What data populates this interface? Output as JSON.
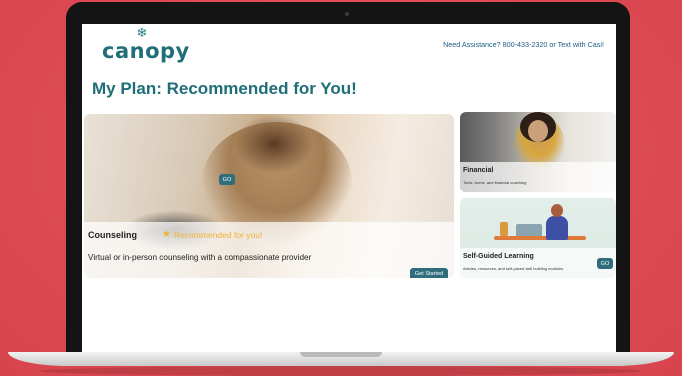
{
  "header": {
    "logo_icon": "snowflake-icon",
    "logo_text": "canopy",
    "assistance": "Need Assistance? 800-433-2320 or Text with Casi!"
  },
  "page": {
    "title": "My Plan: Recommended for You!"
  },
  "counseling": {
    "title": "Counseling",
    "badge": "Recommended for you!",
    "badge_icon": "star-icon",
    "description": "Virtual or in-person counseling with a compassionate provider",
    "button": "Get Started"
  },
  "financial": {
    "title": "Financial",
    "subtitle": "Tools, forms, and financial coaching",
    "button": "GO"
  },
  "self_guided": {
    "title": "Self-Guided Learning",
    "subtitle": "Articles, resources, and self-paced skill building modules",
    "button": "GO"
  },
  "colors": {
    "brand": "#1f6e78",
    "button": "#2f6d7c",
    "badge": "#f2b233",
    "background": "#e04e57"
  }
}
